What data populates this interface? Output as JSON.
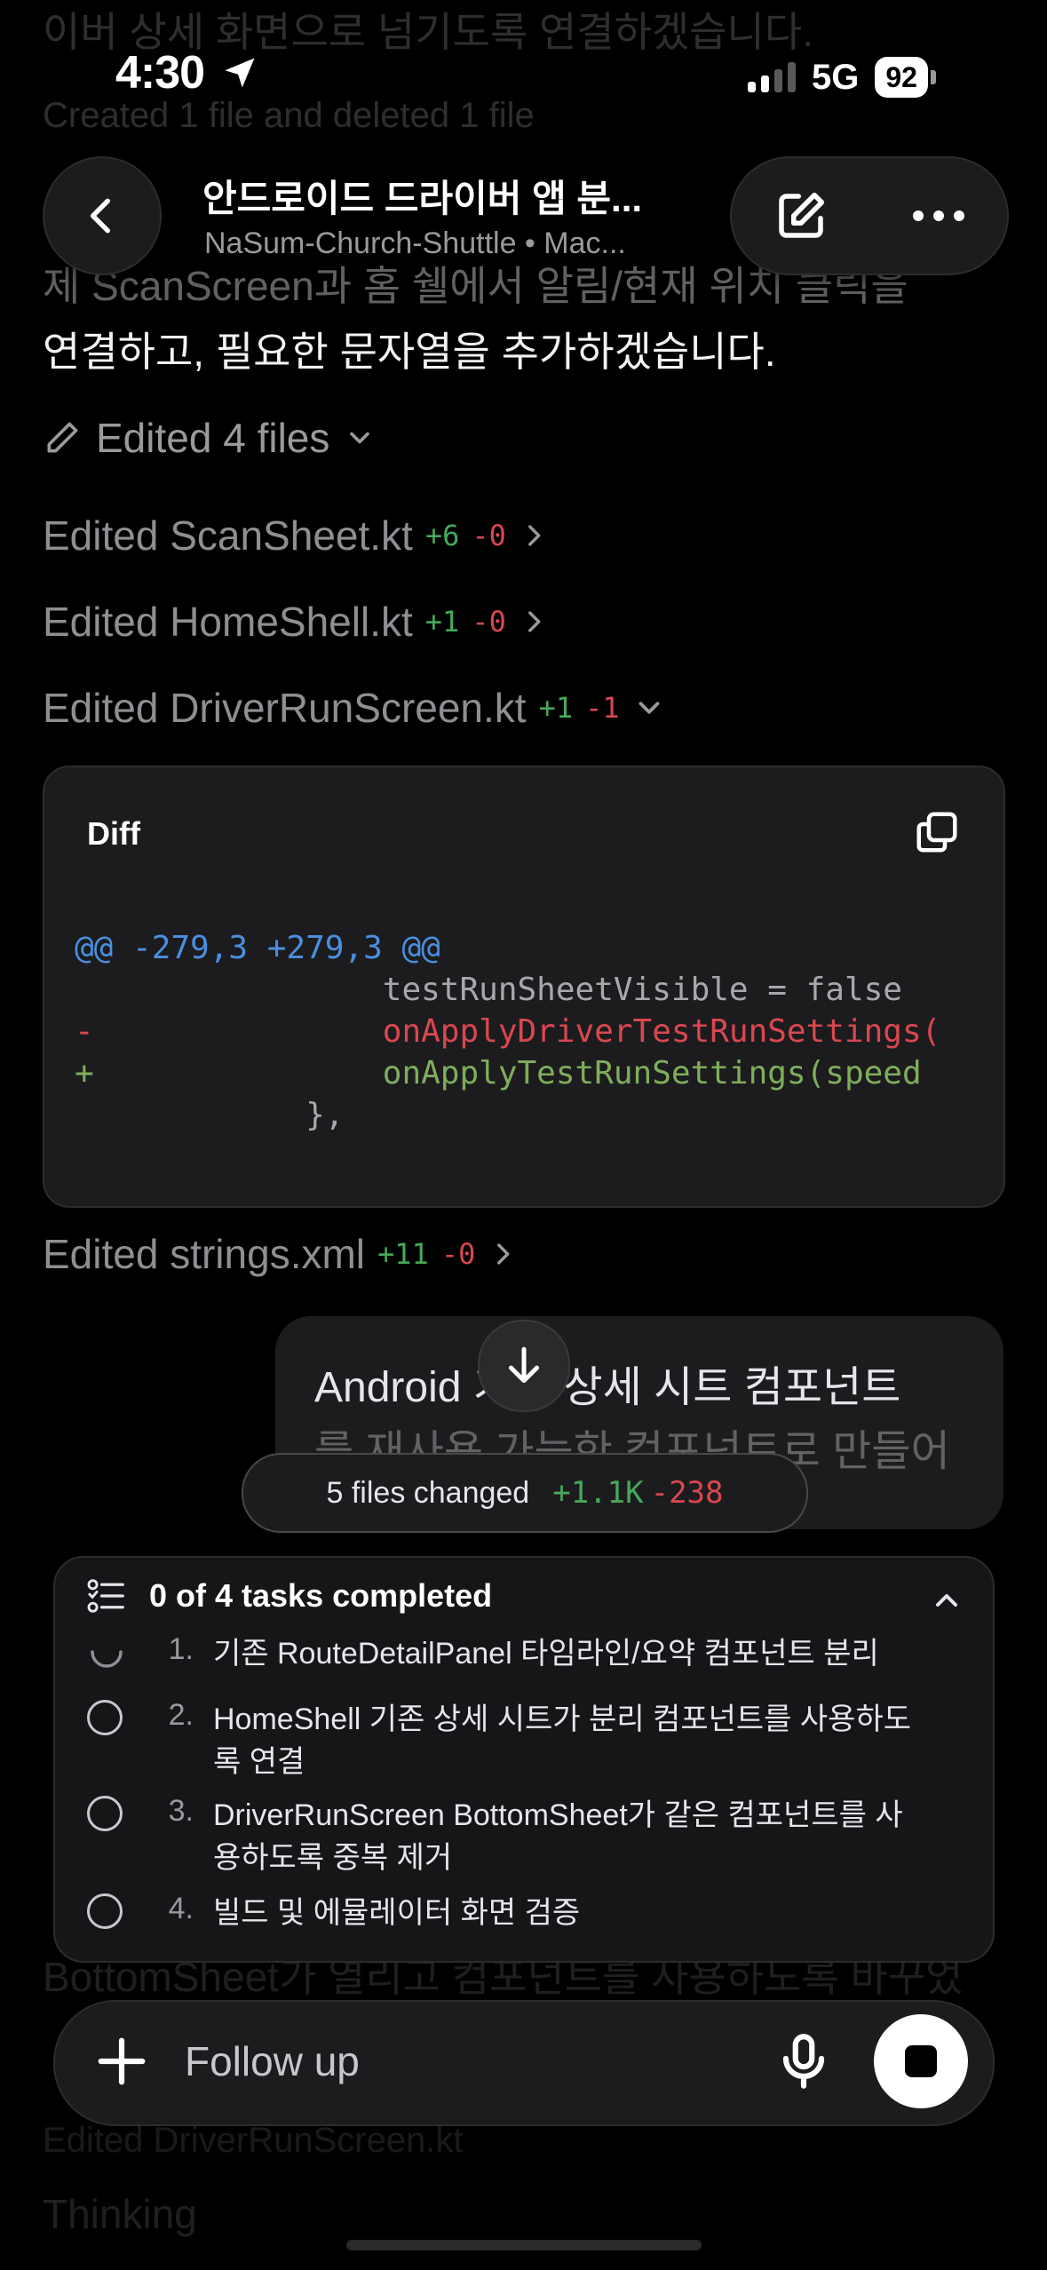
{
  "ghost": {
    "top_line": "이버 상세 화면으로 넘기도록 연결하겠습니다.",
    "changed_line": "Created 1 file and deleted 1 file",
    "behind_header_line": "제 ScanScreen과 홈 쉘에서 알림/현재 위치 클릭을",
    "bottom1": "BottomSheet가 열리고 컴포넌트를 사용하도록 바꾸었",
    "bottom2": "Edited DriverRunScreen.kt",
    "bottom3": "Thinking"
  },
  "status": {
    "time": "4:30",
    "network": "5G",
    "battery": "92"
  },
  "header": {
    "title": "안드로이드 드라이버 앱 분...",
    "subtitle": "NaSum-Church-Shuttle • Mac..."
  },
  "message": {
    "text": "연결하고, 필요한 문자열을 추가하겠습니다."
  },
  "edits": {
    "summary": "Edited 4 files",
    "files": [
      {
        "label": "Edited ScanSheet.kt",
        "plus": "+6",
        "minus": "-0"
      },
      {
        "label": "Edited HomeShell.kt",
        "plus": "+1",
        "minus": "-0"
      },
      {
        "label": "Edited DriverRunScreen.kt",
        "plus": "+1",
        "minus": "-1"
      },
      {
        "label": "Edited strings.xml",
        "plus": "+11",
        "minus": "-0"
      }
    ]
  },
  "diff": {
    "label": "Diff",
    "hunk": "@@ -279,3 +279,3 @@",
    "ctx1": "                testRunSheetVisible = false",
    "del": "-               onApplyDriverTestRunSettings(",
    "add": "+               onApplyTestRunSettings(speed",
    "ctx2": "            },"
  },
  "user_bubble": {
    "line1": "Android 기존 상세 시트 컴포넌트",
    "line2": "를 재사용 가능한 컴포넌트로 만들어"
  },
  "changes": {
    "label": "5 files changed",
    "plus": "+1.1K",
    "minus": "-238"
  },
  "tasks": {
    "title": "0 of 4 tasks completed",
    "items": [
      {
        "num": "1.",
        "text": "기존 RouteDetailPanel 타임라인/요약 컴포넌트 분리"
      },
      {
        "num": "2.",
        "text": "HomeShell 기존 상세 시트가 분리 컴포넌트를 사용하도록 연결"
      },
      {
        "num": "3.",
        "text": "DriverRunScreen BottomSheet가 같은 컴포넌트를 사용하도록 중복 제거"
      },
      {
        "num": "4.",
        "text": "빌드 및 에뮬레이터 화면 검증"
      }
    ]
  },
  "composer": {
    "placeholder": "Follow up"
  }
}
